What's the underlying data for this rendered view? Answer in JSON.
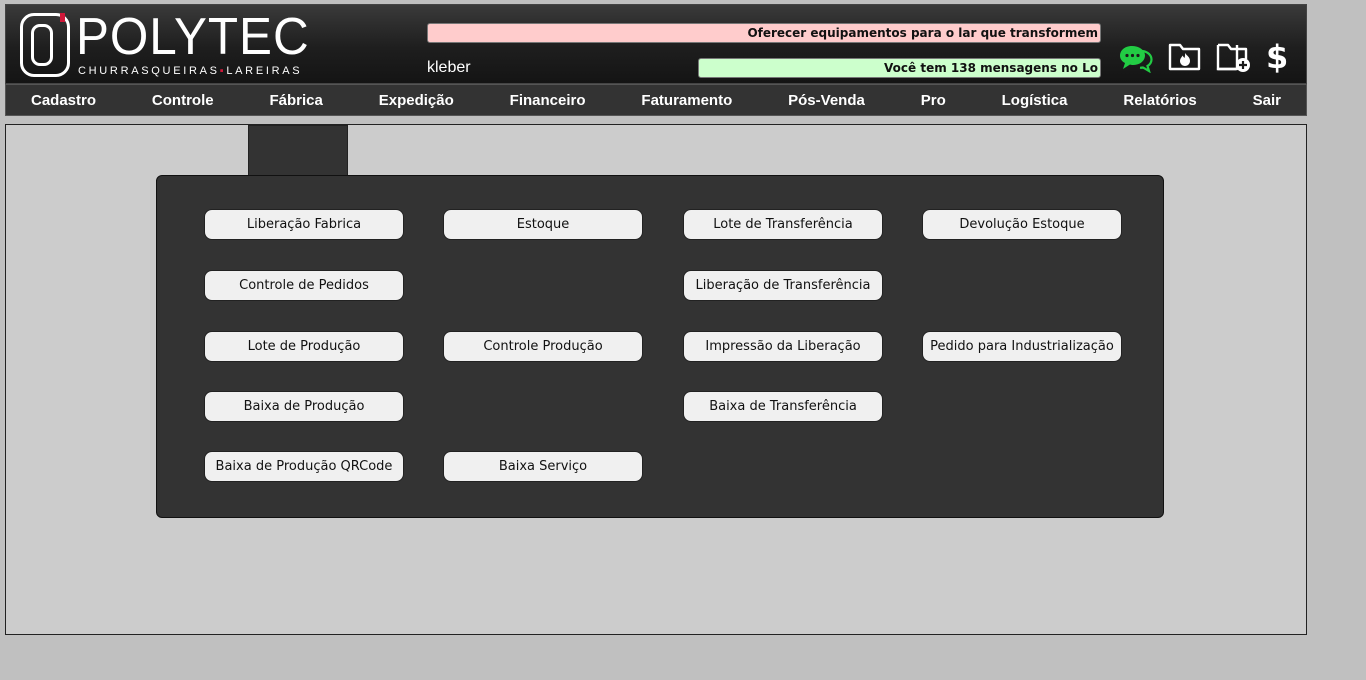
{
  "header": {
    "brand": "POLYTEC",
    "tagline_left": "CHURRASQUEIRAS",
    "tagline_right": "LAREIRAS",
    "ticker_top": "Oferecer equipamentos para o lar que transformem",
    "ticker_bottom": "Você tem 138 mensagens no Lo",
    "username": "kleber",
    "icons": [
      "chat-icon",
      "folder-flame-icon",
      "folder-add-icon",
      "dollar-icon"
    ],
    "dollar_symbol": "$"
  },
  "nav": {
    "items": [
      {
        "label": "Cadastro"
      },
      {
        "label": "Controle"
      },
      {
        "label": "Fábrica"
      },
      {
        "label": "Expedição"
      },
      {
        "label": "Financeiro"
      },
      {
        "label": "Faturamento"
      },
      {
        "label": "Pós-Venda"
      },
      {
        "label": "Pro"
      },
      {
        "label": "Logística"
      },
      {
        "label": "Relatórios"
      },
      {
        "label": "Sair"
      }
    ]
  },
  "menu": {
    "buttons": {
      "liberacao_fabrica": "Liberação Fabrica",
      "estoque": "Estoque",
      "lote_transferencia": "Lote de Transferência",
      "devolucao_estoque": "Devolução Estoque",
      "controle_pedidos": "Controle de Pedidos",
      "liberacao_transferencia": "Liberação de Transferência",
      "lote_producao": "Lote de Produção",
      "controle_producao": "Controle Produção",
      "impressao_liberacao": "Impressão da Liberação",
      "pedido_industrializacao": "Pedido para Industrialização",
      "baixa_producao": "Baixa de Produção",
      "baixa_transferencia": "Baixa de Transferência",
      "baixa_producao_qrcode": "Baixa de Produção QRCode",
      "baixa_servico": "Baixa Serviço"
    }
  },
  "colors": {
    "chat_icon": "#22cc44",
    "ticker_top_bg": "#ffcccc",
    "ticker_bottom_bg": "#ccffcc",
    "brand_accent": "#d0183a"
  }
}
